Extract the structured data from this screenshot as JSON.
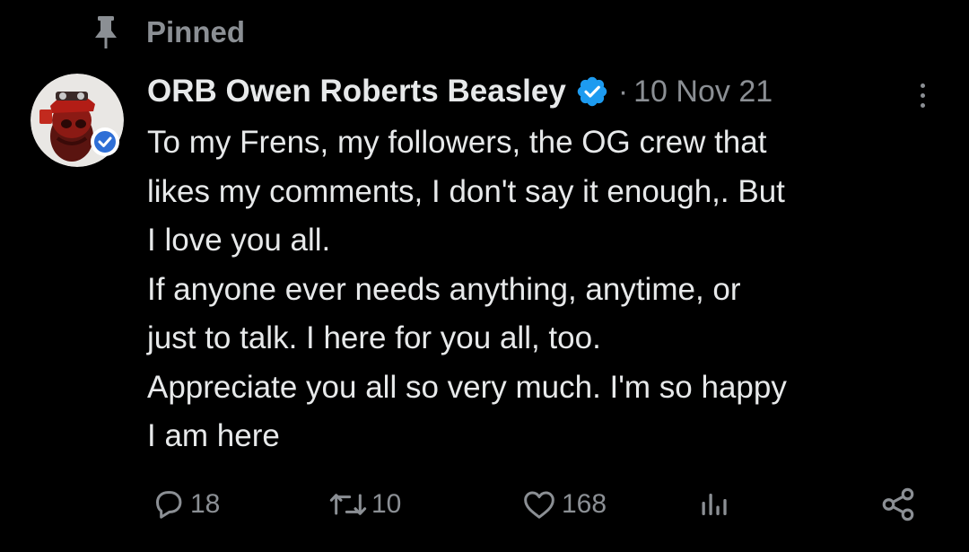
{
  "pinned": {
    "label": "Pinned",
    "icon": "pin-icon"
  },
  "tweet": {
    "author": {
      "display_name": "ORB Owen Roberts Beasley",
      "verified": true,
      "verified_color": "#1d9bf0"
    },
    "separator": "·",
    "timestamp": "10 Nov 21",
    "text_lines": [
      "To my Frens, my followers, the OG crew that",
      "likes my comments, I don't say it enough,. But",
      "I love you all.",
      "If anyone ever needs anything, anytime, or",
      "just to talk. I here for you all, too.",
      "Appreciate you all so very much. I'm so happy",
      "I am here"
    ],
    "actions": {
      "reply": {
        "count": "18",
        "icon": "reply-icon"
      },
      "repost": {
        "count": "10",
        "icon": "repost-icon"
      },
      "like": {
        "count": "168",
        "icon": "heart-icon"
      },
      "views": {
        "icon": "analytics-icon"
      },
      "share": {
        "icon": "share-icon"
      }
    }
  },
  "colors": {
    "background": "#000000",
    "text_primary": "#e7e9ea",
    "text_secondary": "#8b8f94",
    "accent": "#1d9bf0"
  }
}
